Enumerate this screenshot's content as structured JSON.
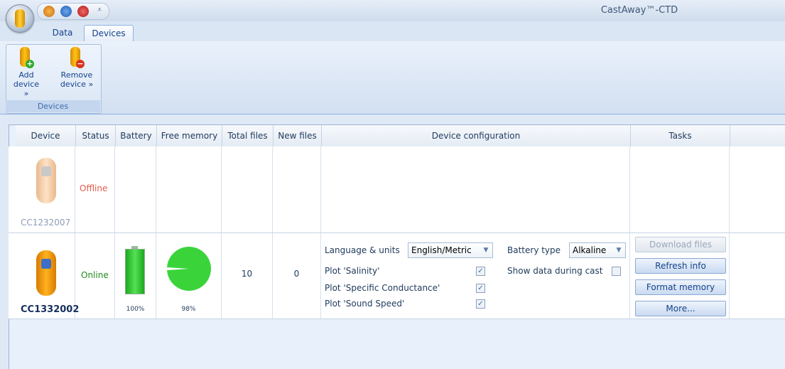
{
  "window": {
    "title": "CastAway™-CTD"
  },
  "tabs": [
    {
      "label": "Data"
    },
    {
      "label": "Devices"
    }
  ],
  "ribbon": {
    "group_label": "Devices",
    "add_label_1": "Add",
    "add_label_2": "device »",
    "remove_label_1": "Remove",
    "remove_label_2": "device »"
  },
  "table": {
    "columns": [
      "Device",
      "Status",
      "Battery",
      "Free memory",
      "Total files",
      "New files",
      "Device configuration",
      "Tasks"
    ],
    "rows": [
      {
        "device_id": "CC1232007",
        "status": "Offline"
      },
      {
        "device_id": "CC1332002",
        "status": "Online",
        "battery_pct": "100%",
        "battery_level": 1.0,
        "free_memory_pct": "98%",
        "free_memory_fraction": 0.98,
        "total_files": "10",
        "new_files": "0"
      }
    ]
  },
  "config": {
    "language_label": "Language & units",
    "language_value": "English/Metric",
    "battery_type_label": "Battery type",
    "battery_type_value": "Alkaline",
    "show_data_label": "Show data during cast",
    "plot_salinity": "Plot 'Salinity'",
    "plot_conductance": "Plot 'Specific Conductance'",
    "plot_sound_speed": "Plot 'Sound Speed'"
  },
  "tasks": {
    "download": "Download files",
    "refresh": "Refresh info",
    "format": "Format memory",
    "more": "More..."
  },
  "colors": {
    "offline": "#e35b4b",
    "online": "#1e8b1e",
    "green": "#3ad43a",
    "orange": "#ff9e12"
  }
}
